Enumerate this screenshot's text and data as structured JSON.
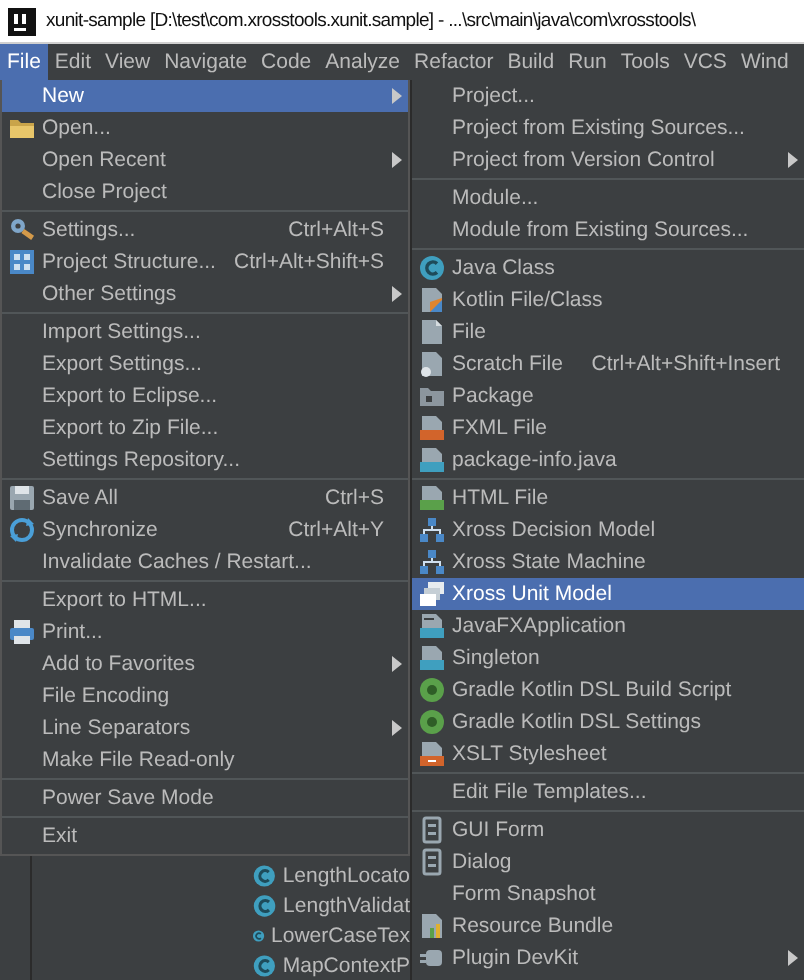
{
  "window": {
    "title": "xunit-sample [D:\\test\\com.xrosstools.xunit.sample] - ...\\src\\main\\java\\com\\xrosstools\\"
  },
  "menubar": [
    {
      "label": "File",
      "selected": true
    },
    {
      "label": "Edit",
      "selected": false
    },
    {
      "label": "View",
      "selected": false
    },
    {
      "label": "Navigate",
      "selected": false
    },
    {
      "label": "Code",
      "selected": false
    },
    {
      "label": "Analyze",
      "selected": false
    },
    {
      "label": "Refactor",
      "selected": false
    },
    {
      "label": "Build",
      "selected": false
    },
    {
      "label": "Run",
      "selected": false
    },
    {
      "label": "Tools",
      "selected": false
    },
    {
      "label": "VCS",
      "selected": false
    },
    {
      "label": "Wind",
      "selected": false
    }
  ],
  "file_menu": [
    {
      "kind": "item",
      "label": "New",
      "submenu": true,
      "selected": true
    },
    {
      "kind": "item",
      "label": "Open...",
      "selected": false
    },
    {
      "kind": "item",
      "label": "Open Recent",
      "submenu": true,
      "selected": false
    },
    {
      "kind": "item",
      "label": "Close Project",
      "selected": false
    },
    {
      "kind": "separator"
    },
    {
      "kind": "item",
      "label": "Settings...",
      "shortcut": "Ctrl+Alt+S",
      "selected": false
    },
    {
      "kind": "item",
      "label": "Project Structure...",
      "shortcut": "Ctrl+Alt+Shift+S",
      "selected": false
    },
    {
      "kind": "item",
      "label": "Other Settings",
      "submenu": true,
      "selected": false
    },
    {
      "kind": "separator"
    },
    {
      "kind": "item",
      "label": "Import Settings...",
      "selected": false
    },
    {
      "kind": "item",
      "label": "Export Settings...",
      "selected": false
    },
    {
      "kind": "item",
      "label": "Export to Eclipse...",
      "selected": false
    },
    {
      "kind": "item",
      "label": "Export to Zip File...",
      "selected": false
    },
    {
      "kind": "item",
      "label": "Settings Repository...",
      "selected": false
    },
    {
      "kind": "separator"
    },
    {
      "kind": "item",
      "label": "Save All",
      "shortcut": "Ctrl+S",
      "selected": false
    },
    {
      "kind": "item",
      "label": "Synchronize",
      "shortcut": "Ctrl+Alt+Y",
      "selected": false
    },
    {
      "kind": "item",
      "label": "Invalidate Caches / Restart...",
      "selected": false
    },
    {
      "kind": "separator"
    },
    {
      "kind": "item",
      "label": "Export to HTML...",
      "selected": false
    },
    {
      "kind": "item",
      "label": "Print...",
      "selected": false
    },
    {
      "kind": "item",
      "label": "Add to Favorites",
      "submenu": true,
      "selected": false
    },
    {
      "kind": "item",
      "label": "File Encoding",
      "selected": false
    },
    {
      "kind": "item",
      "label": "Line Separators",
      "submenu": true,
      "selected": false
    },
    {
      "kind": "item",
      "label": "Make File Read-only",
      "selected": false
    },
    {
      "kind": "separator"
    },
    {
      "kind": "item",
      "label": "Power Save Mode",
      "selected": false
    },
    {
      "kind": "separator"
    },
    {
      "kind": "item",
      "label": "Exit",
      "selected": false
    }
  ],
  "new_submenu": [
    {
      "kind": "item",
      "label": "Project...",
      "selected": false
    },
    {
      "kind": "item",
      "label": "Project from Existing Sources...",
      "selected": false
    },
    {
      "kind": "item",
      "label": "Project from Version Control",
      "submenu": true,
      "selected": false
    },
    {
      "kind": "separator"
    },
    {
      "kind": "item",
      "label": "Module...",
      "selected": false
    },
    {
      "kind": "item",
      "label": "Module from Existing Sources...",
      "selected": false
    },
    {
      "kind": "separator"
    },
    {
      "kind": "item",
      "label": "Java Class",
      "selected": false
    },
    {
      "kind": "item",
      "label": "Kotlin File/Class",
      "selected": false
    },
    {
      "kind": "item",
      "label": "File",
      "selected": false
    },
    {
      "kind": "item",
      "label": "Scratch File",
      "shortcut": "Ctrl+Alt+Shift+Insert",
      "selected": false
    },
    {
      "kind": "item",
      "label": "Package",
      "selected": false
    },
    {
      "kind": "item",
      "label": "FXML File",
      "selected": false
    },
    {
      "kind": "item",
      "label": "package-info.java",
      "selected": false
    },
    {
      "kind": "separator"
    },
    {
      "kind": "item",
      "label": "HTML File",
      "selected": false
    },
    {
      "kind": "item",
      "label": "Xross Decision Model",
      "selected": false
    },
    {
      "kind": "item",
      "label": "Xross State Machine",
      "selected": false
    },
    {
      "kind": "item",
      "label": "Xross Unit Model",
      "selected": true
    },
    {
      "kind": "item",
      "label": "JavaFXApplication",
      "selected": false
    },
    {
      "kind": "item",
      "label": "Singleton",
      "selected": false
    },
    {
      "kind": "item",
      "label": "Gradle Kotlin DSL Build Script",
      "selected": false
    },
    {
      "kind": "item",
      "label": "Gradle Kotlin DSL Settings",
      "selected": false
    },
    {
      "kind": "item",
      "label": "XSLT Stylesheet",
      "selected": false
    },
    {
      "kind": "separator"
    },
    {
      "kind": "item",
      "label": "Edit File Templates...",
      "selected": false
    },
    {
      "kind": "separator"
    },
    {
      "kind": "item",
      "label": "GUI Form",
      "selected": false
    },
    {
      "kind": "item",
      "label": "Dialog",
      "selected": false
    },
    {
      "kind": "item",
      "label": "Form Snapshot",
      "selected": false
    },
    {
      "kind": "item",
      "label": "Resource Bundle",
      "selected": false
    },
    {
      "kind": "item",
      "label": "Plugin DevKit",
      "submenu": true,
      "selected": false
    }
  ],
  "project_tree": [
    {
      "label": "LengthLocato"
    },
    {
      "label": "LengthValidat"
    },
    {
      "label": "LowerCaseTex"
    },
    {
      "label": "MapContextP"
    }
  ]
}
